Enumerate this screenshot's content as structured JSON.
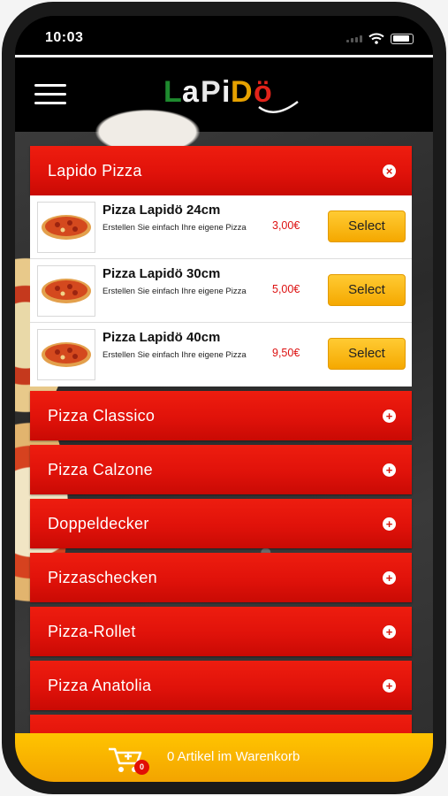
{
  "status_bar": {
    "time": "10:03"
  },
  "header": {
    "logo_text": "LaPiDö"
  },
  "colors": {
    "brand_red": "#e0120a",
    "button_yellow": "#f5b400",
    "price_red": "#dd1111"
  },
  "categories": [
    {
      "label": "Lapido Pizza",
      "icon": "close-circle-icon",
      "expanded": true,
      "items": [
        {
          "name": "Pizza Lapidö 24cm",
          "description": "Erstellen Sie einfach Ihre eigene Pizza",
          "price": "3,00€",
          "button": "Select"
        },
        {
          "name": "Pizza Lapidö 30cm",
          "description": "Erstellen Sie einfach Ihre eigene Pizza",
          "price": "5,00€",
          "button": "Select"
        },
        {
          "name": "Pizza Lapidö 40cm",
          "description": "Erstellen Sie einfach Ihre eigene Pizza",
          "price": "9,50€",
          "button": "Select"
        }
      ]
    },
    {
      "label": "Pizza Classico",
      "icon": "plus-circle-icon"
    },
    {
      "label": "Pizza Calzone",
      "icon": "plus-circle-icon"
    },
    {
      "label": "Doppeldecker",
      "icon": "plus-circle-icon"
    },
    {
      "label": "Pizzaschecken",
      "icon": "plus-circle-icon"
    },
    {
      "label": "Pizza-Rollet",
      "icon": "plus-circle-icon"
    },
    {
      "label": "Pizza Anatolia",
      "icon": "plus-circle-icon"
    }
  ],
  "cart": {
    "badge_count": "0",
    "label": "0 Artikel im Warenkorb"
  }
}
